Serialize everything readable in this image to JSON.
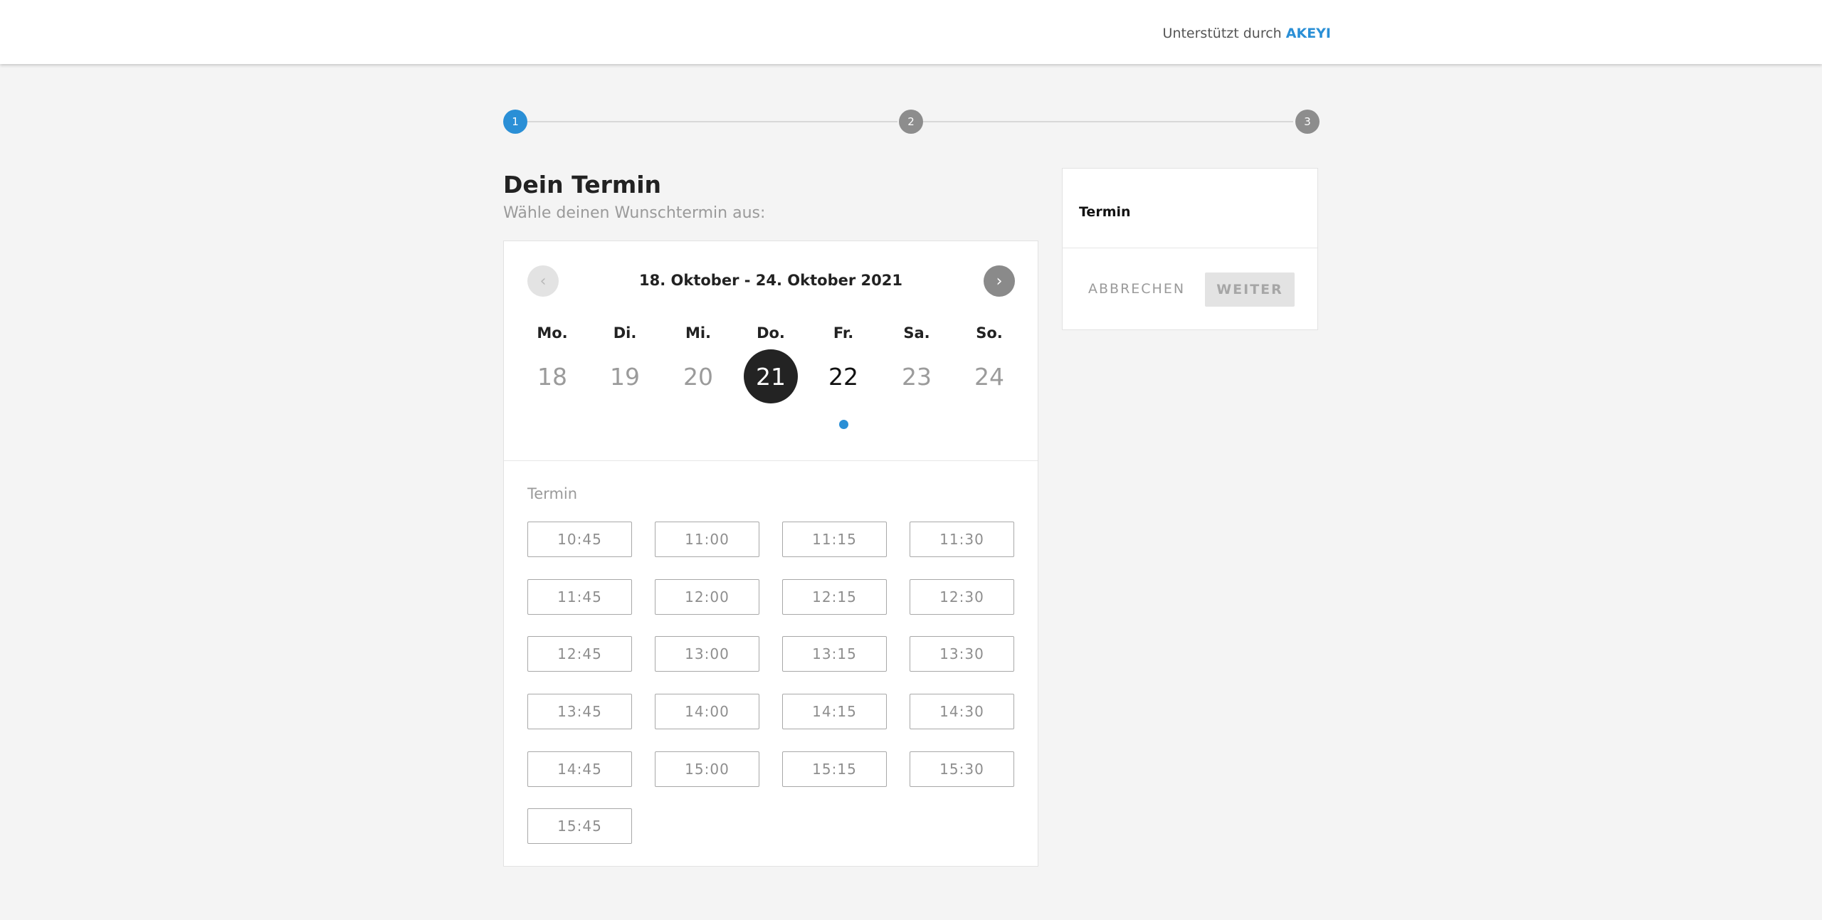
{
  "header": {
    "powered_by_prefix": "Unterstützt durch",
    "brand": "AKEYI",
    "brand_color": "#2a8fd6"
  },
  "stepper": {
    "steps": [
      "1",
      "2",
      "3"
    ],
    "current_step": 1
  },
  "main": {
    "title": "Dein Termin",
    "subtitle": "Wähle deinen Wunschtermin aus:"
  },
  "calendar": {
    "range_label": "18. Oktober - 24. Oktober 2021",
    "prev_icon": "chevron-left-icon",
    "next_icon": "chevron-right-icon",
    "days": [
      {
        "name": "Mo.",
        "number": "18",
        "state": "disabled"
      },
      {
        "name": "Di.",
        "number": "19",
        "state": "disabled"
      },
      {
        "name": "Mi.",
        "number": "20",
        "state": "disabled"
      },
      {
        "name": "Do.",
        "number": "21",
        "state": "selected"
      },
      {
        "name": "Fr.",
        "number": "22",
        "state": "available"
      },
      {
        "name": "Sa.",
        "number": "23",
        "state": "disabled"
      },
      {
        "name": "So.",
        "number": "24",
        "state": "disabled"
      }
    ],
    "slots_label": "Termin",
    "slots": [
      "10:45",
      "11:00",
      "11:15",
      "11:30",
      "11:45",
      "12:00",
      "12:15",
      "12:30",
      "12:45",
      "13:00",
      "13:15",
      "13:30",
      "13:45",
      "14:00",
      "14:15",
      "14:30",
      "14:45",
      "15:00",
      "15:15",
      "15:30",
      "15:45"
    ]
  },
  "summary": {
    "title": "Termin",
    "cancel_label": "ABBRECHEN",
    "next_label": "WEITER"
  }
}
